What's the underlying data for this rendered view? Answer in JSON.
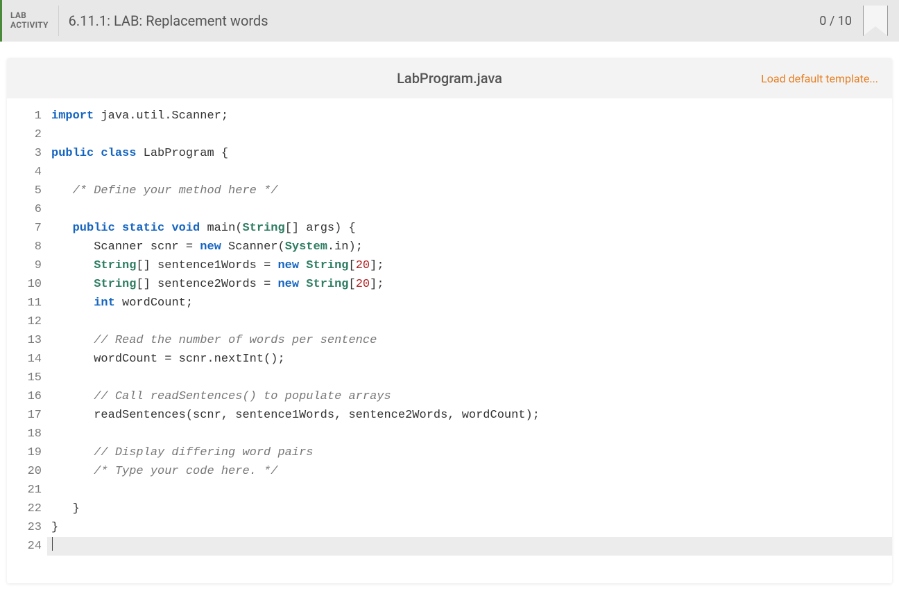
{
  "header": {
    "pill_line1": "LAB",
    "pill_line2": "ACTIVITY",
    "title": "6.11.1: LAB: Replacement words",
    "score": "0 / 10"
  },
  "editor": {
    "filename": "LabProgram.java",
    "load_template_label": "Load default template..."
  },
  "code": {
    "line_count": 24,
    "highlight_line": 24,
    "lines": [
      [
        [
          "kw",
          "import"
        ],
        [
          "",
          " java.util.Scanner;"
        ]
      ],
      [],
      [
        [
          "kw",
          "public"
        ],
        [
          "",
          " "
        ],
        [
          "kw",
          "class"
        ],
        [
          "",
          " LabProgram {"
        ]
      ],
      [],
      [
        [
          "",
          "   "
        ],
        [
          "cm",
          "/* Define your method here */"
        ]
      ],
      [],
      [
        [
          "",
          "   "
        ],
        [
          "kw",
          "public"
        ],
        [
          "",
          " "
        ],
        [
          "kw",
          "static"
        ],
        [
          "",
          " "
        ],
        [
          "kw",
          "void"
        ],
        [
          "",
          " main("
        ],
        [
          "type",
          "String"
        ],
        [
          "",
          "[] args) {"
        ]
      ],
      [
        [
          "",
          "      Scanner scnr = "
        ],
        [
          "kw",
          "new"
        ],
        [
          "",
          " Scanner("
        ],
        [
          "type",
          "System"
        ],
        [
          "",
          ".in);"
        ]
      ],
      [
        [
          "",
          "      "
        ],
        [
          "type",
          "String"
        ],
        [
          "",
          "[] sentence1Words = "
        ],
        [
          "kw",
          "new"
        ],
        [
          "",
          " "
        ],
        [
          "type",
          "String"
        ],
        [
          "",
          "["
        ],
        [
          "num",
          "20"
        ],
        [
          "",
          "];"
        ]
      ],
      [
        [
          "",
          "      "
        ],
        [
          "type",
          "String"
        ],
        [
          "",
          "[] sentence2Words = "
        ],
        [
          "kw",
          "new"
        ],
        [
          "",
          " "
        ],
        [
          "type",
          "String"
        ],
        [
          "",
          "["
        ],
        [
          "num",
          "20"
        ],
        [
          "",
          "];"
        ]
      ],
      [
        [
          "",
          "      "
        ],
        [
          "kw",
          "int"
        ],
        [
          "",
          " wordCount;"
        ]
      ],
      [],
      [
        [
          "",
          "      "
        ],
        [
          "cm",
          "// Read the number of words per sentence"
        ]
      ],
      [
        [
          "",
          "      wordCount = scnr.nextInt();"
        ]
      ],
      [],
      [
        [
          "",
          "      "
        ],
        [
          "cm",
          "// Call readSentences() to populate arrays"
        ]
      ],
      [
        [
          "",
          "      readSentences(scnr, sentence1Words, sentence2Words, wordCount);"
        ]
      ],
      [],
      [
        [
          "",
          "      "
        ],
        [
          "cm",
          "// Display differing word pairs"
        ]
      ],
      [
        [
          "",
          "      "
        ],
        [
          "cm",
          "/* Type your code here. */"
        ]
      ],
      [],
      [
        [
          "",
          "   }"
        ]
      ],
      [
        [
          "",
          "}"
        ]
      ],
      []
    ]
  }
}
